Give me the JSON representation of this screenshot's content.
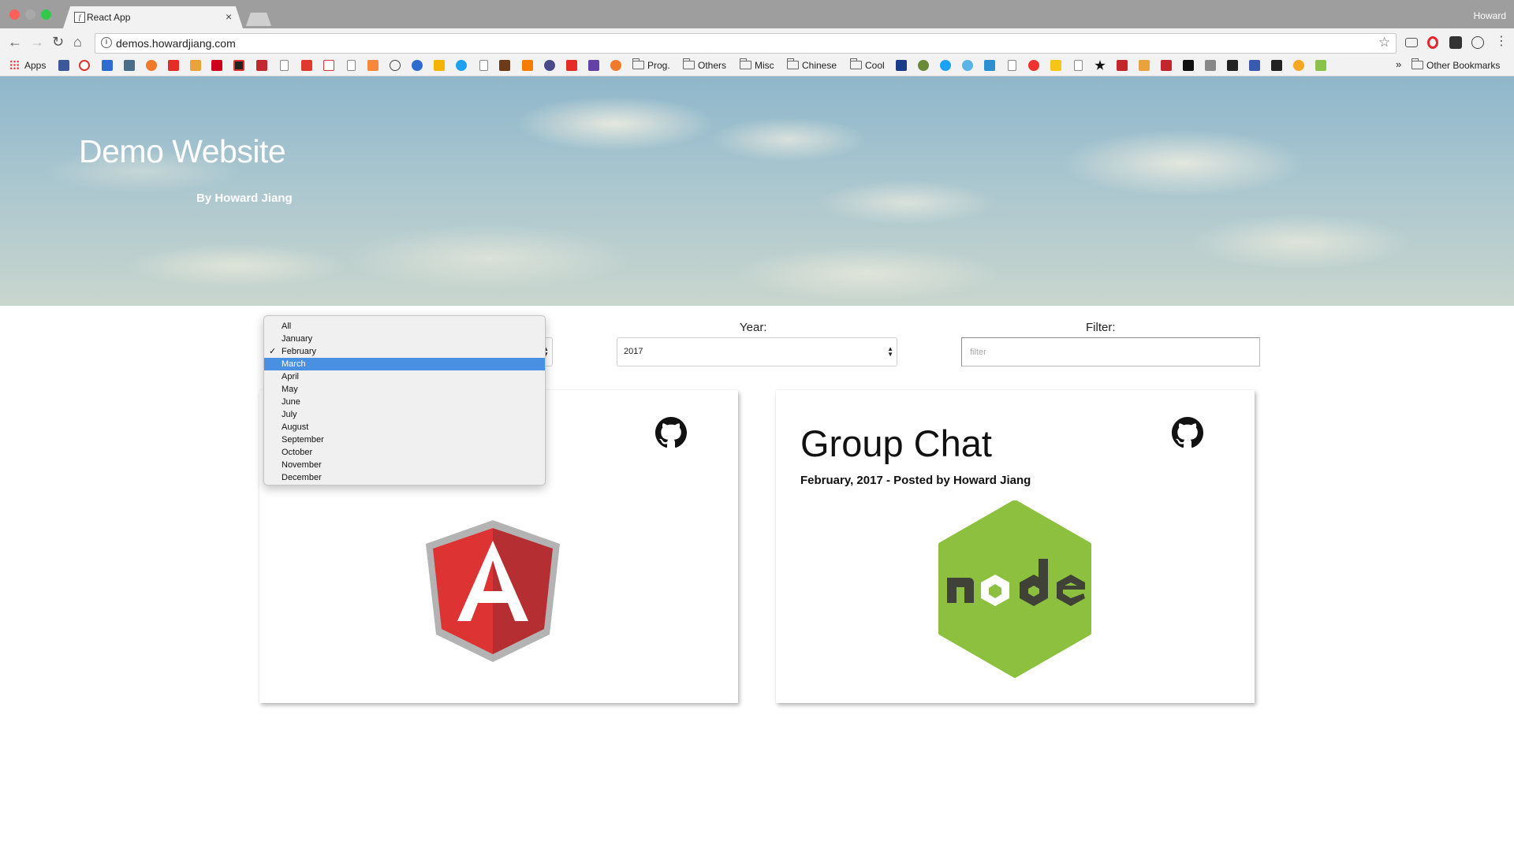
{
  "browser": {
    "tab_title": "React App",
    "tab_close": "×",
    "profile_name": "Howard",
    "url": "demos.howardjiang.com",
    "nav": {
      "back": "←",
      "forward": "→",
      "reload": "↻",
      "home": "⌂",
      "star": "☆",
      "menu": "⋮"
    }
  },
  "bookmarks": {
    "apps_label": "Apps",
    "folders": [
      "Prog.",
      "Others",
      "Misc",
      "Chinese",
      "Cool"
    ],
    "other_label": "Other Bookmarks",
    "overflow": "»"
  },
  "hero": {
    "title": "Demo Website",
    "subtitle": "By Howard Jiang"
  },
  "filters": {
    "year_label": "Year:",
    "year_value": "2017",
    "filter_label": "Filter:",
    "filter_placeholder": "filter"
  },
  "month_dropdown": {
    "options": [
      "All",
      "January",
      "February",
      "March",
      "April",
      "May",
      "June",
      "July",
      "August",
      "September",
      "October",
      "November",
      "December"
    ],
    "checked": "February",
    "highlighted": "March",
    "check_mark": "✓"
  },
  "cards": [
    {
      "title": "",
      "meta": "",
      "logo": "angular-logo"
    },
    {
      "title": "Group Chat",
      "meta": "February, 2017 - Posted by Howard Jiang",
      "logo": "nodejs-logo"
    }
  ],
  "colors": {
    "angular_red": "#dd3333",
    "angular_dark_red": "#b52e31",
    "node_green": "#8cc03e",
    "node_dark": "#404137",
    "highlight_blue": "#4a90e2"
  }
}
